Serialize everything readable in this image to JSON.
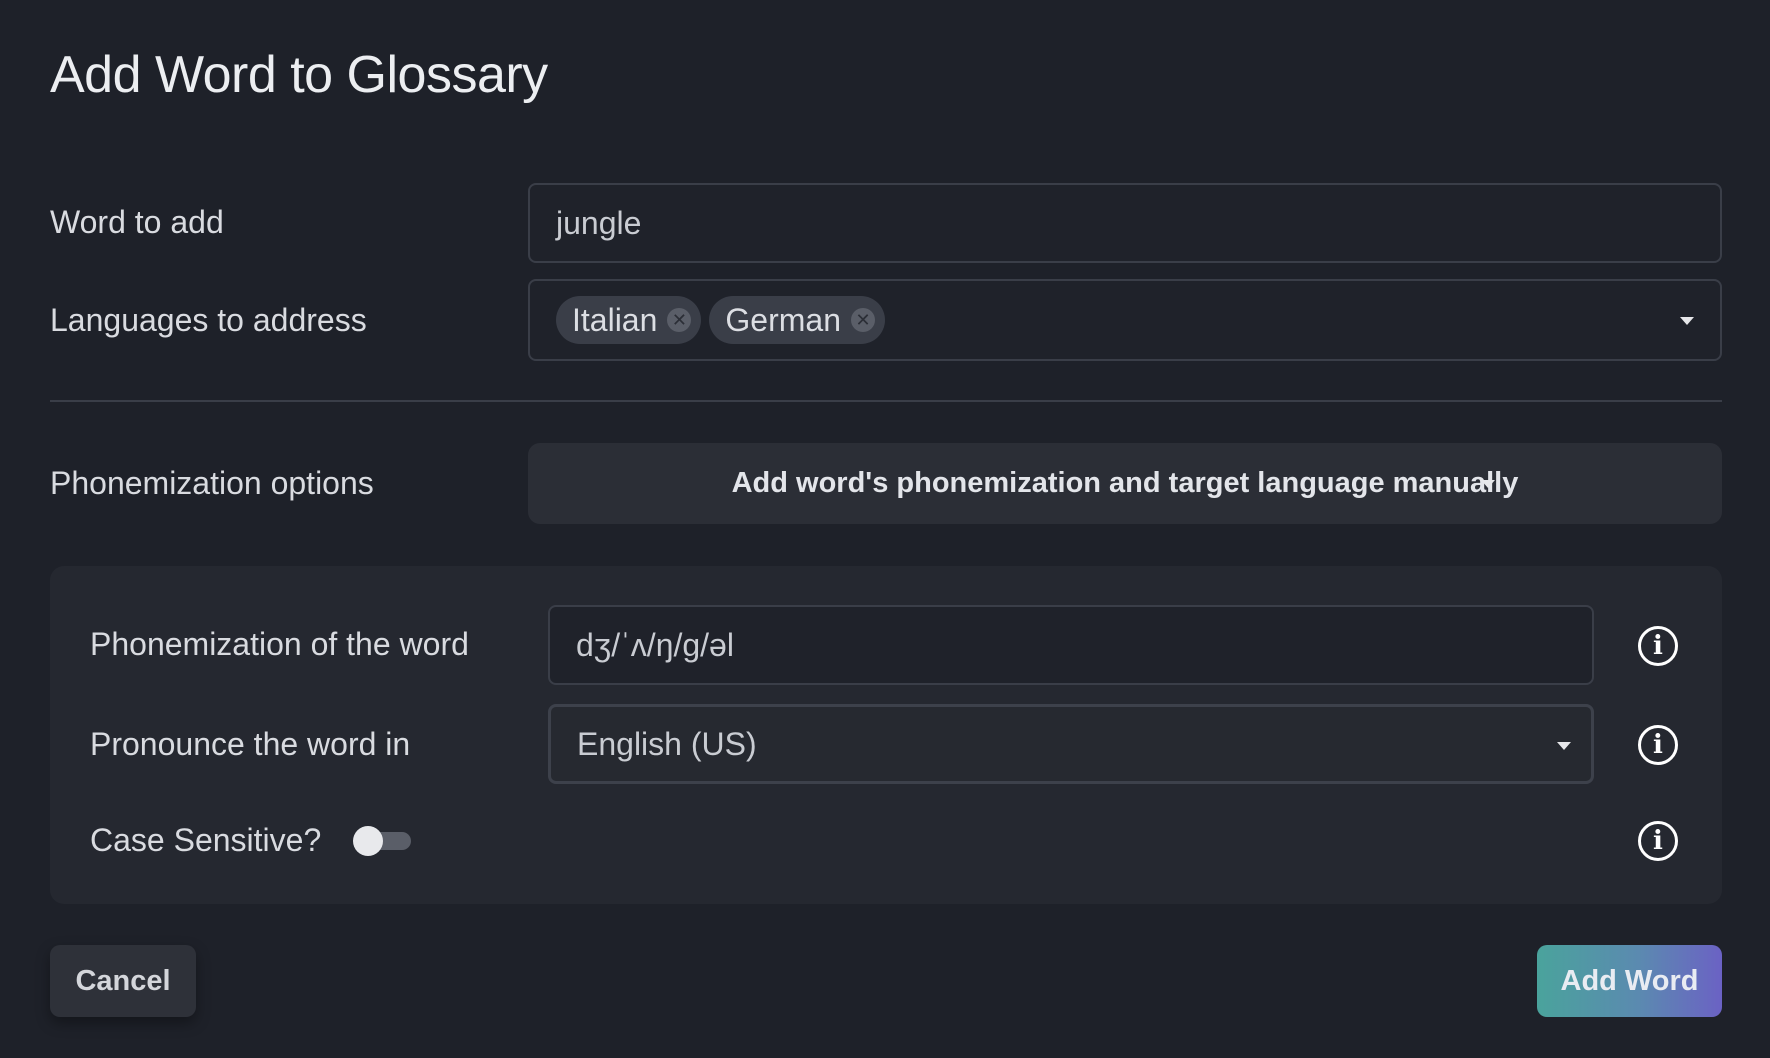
{
  "dialog": {
    "title": "Add Word to Glossary"
  },
  "word": {
    "label": "Word to add",
    "value": "jungle"
  },
  "languages": {
    "label": "Languages to address",
    "chips": [
      "Italian",
      "German"
    ]
  },
  "phonemization_options": {
    "label": "Phonemization options",
    "selected": "Add word's phonemization and target language manually"
  },
  "panel": {
    "phonemization": {
      "label": "Phonemization of the word",
      "value": "dʒ/ˈʌ/ŋ/g/əl"
    },
    "pronounce": {
      "label": "Pronounce the word in",
      "value": "English (US)"
    },
    "case_sensitive": {
      "label": "Case Sensitive?",
      "enabled": false
    },
    "info_glyph": "i"
  },
  "buttons": {
    "cancel": "Cancel",
    "add": "Add Word"
  },
  "colors": {
    "background": "#1e2129",
    "panel": "#252830",
    "accent_start": "#4aa39c",
    "accent_end": "#6b62c4"
  },
  "icons": {
    "chip_remove": "close-circle-icon",
    "dropdown": "caret-down-icon",
    "info": "info-circle-icon"
  }
}
